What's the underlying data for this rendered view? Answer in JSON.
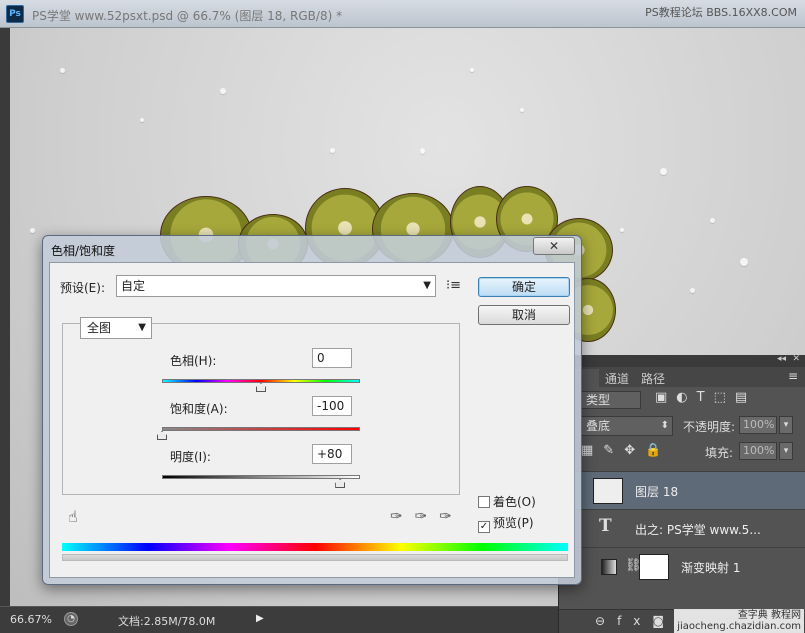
{
  "app": {
    "logo": "Ps",
    "title": "PS学堂 www.52psxt.psd @ 66.7% (图层 18, RGB/8) *",
    "watermark_top": "PS教程论坛 BBS.16XX8.COM"
  },
  "status": {
    "zoom": "66.67%",
    "doc_info": "文档:2.85M/78.0M"
  },
  "dialog": {
    "title": "色相/饱和度",
    "close": "✕",
    "preset_label": "预设(E):",
    "preset_value": "自定",
    "ok": "确定",
    "cancel": "取消",
    "edit_value": "全图",
    "sliders": [
      {
        "label": "色相(H):",
        "value": "0",
        "fraction": 0.5
      },
      {
        "label": "饱和度(A):",
        "value": "-100",
        "fraction": 0.0
      },
      {
        "label": "明度(I):",
        "value": "+80",
        "fraction": 0.9
      }
    ],
    "colorize": {
      "label": "着色(O)",
      "checked": false
    },
    "preview": {
      "label": "预览(P)",
      "checked": true
    }
  },
  "layers_panel": {
    "tabs": [
      "",
      "通道",
      "路径"
    ],
    "kind": "类型",
    "blend_mode": "叠底",
    "opacity_label": "不透明度:",
    "opacity_value": "100%",
    "fill_label": "填充:",
    "fill_value": "100%",
    "layers": [
      {
        "name": "图层 18",
        "selected": true,
        "type": "pixel"
      },
      {
        "name": "出之: PS学堂    www.5...",
        "selected": false,
        "type": "text"
      },
      {
        "name": "渐变映射 1",
        "selected": false,
        "type": "adjustment"
      }
    ],
    "watermark_bottom": "查字典 教程网\njiaocheng.chazidian.com"
  }
}
